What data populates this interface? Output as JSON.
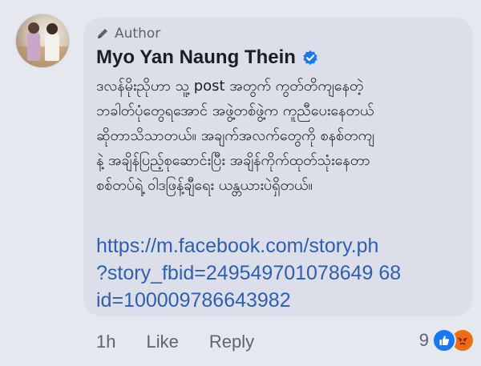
{
  "comment": {
    "role_badge": "Author",
    "author_name": "Myo Yan Naung Thein",
    "body_lines": [
      "ဒလန်မိုးညိုဟာ သူ့ post အတွက် ကွတ်တိကျနေတဲ့",
      "ဘခါတ်ပုံတွေရအောင် အဖွဲ့တစ်ဖွဲ့က ကူညီပေးနေတယ်",
      "ဆိုတာသိသာတယ်။ အချက်အလက်တွေကို စနစ်တကျ",
      "နဲ့ အချိန်ပြည့်စုဆောင်းပြီး အချိန်ကိုက်ထုတ်သုံးနေတာ",
      "စစ်တပ်ရဲ့ ဝါဒဖြန့်ချီရေး ယန္တယားပဲရှိတယ်။"
    ],
    "link_lines": [
      "https://m.facebook.com/story.ph",
      "?story_fbid=249549701078649 68",
      "id=100009786643982"
    ]
  },
  "actions": {
    "time": "1h",
    "like": "Like",
    "reply": "Reply"
  },
  "reactions": {
    "count": "9",
    "types": [
      "like-icon",
      "angry-icon"
    ]
  },
  "colors": {
    "background": "#e6e8ef",
    "bubble": "#dcdfe9",
    "link": "#2e5fae",
    "verified": "#1877f2"
  }
}
